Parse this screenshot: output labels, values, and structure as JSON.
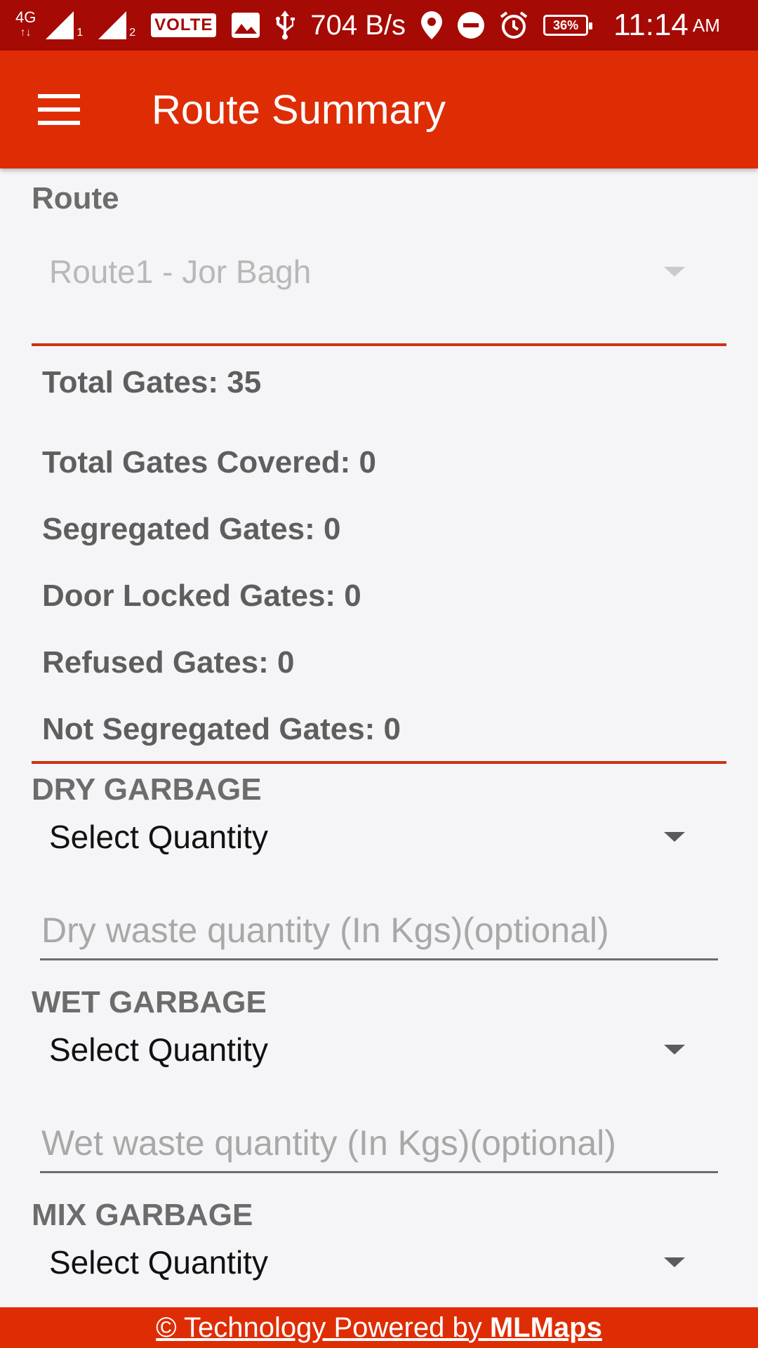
{
  "status_bar": {
    "network": "4G",
    "network_arrows": "↑↓",
    "sim1": "1",
    "sim2": "2",
    "volte": "VOLTE",
    "speed": "704 B/s",
    "battery": "36%",
    "time": "11:14",
    "ampm": "AM",
    "icons": [
      "signal-icon",
      "image-icon",
      "usb-icon",
      "location-icon",
      "do-not-disturb-icon",
      "alarm-icon",
      "battery-icon"
    ]
  },
  "app_bar": {
    "title": "Route Summary",
    "menu_icon": "hamburger-menu-icon",
    "color": "#de2d05"
  },
  "route": {
    "label": "Route",
    "selected": "Route1 - Jor Bagh"
  },
  "stats": {
    "total_gates": "Total Gates: 35",
    "covered": "Total Gates Covered: 0",
    "segregated": "Segregated Gates: 0",
    "door_locked": "Door Locked Gates: 0",
    "refused": "Refused Gates: 0",
    "not_segregated": "Not Segregated Gates: 0"
  },
  "dry": {
    "label": "DRY GARBAGE",
    "select": "Select Quantity",
    "placeholder": "Dry waste quantity (In Kgs)(optional)"
  },
  "wet": {
    "label": "WET GARBAGE",
    "select": "Select Quantity",
    "placeholder": "Wet waste quantity (In Kgs)(optional)"
  },
  "mix": {
    "label": "MIX GARBAGE",
    "select": "Select Quantity"
  },
  "footer": {
    "prefix": "© Technology Powered by ",
    "brand": "MLMaps"
  },
  "colors": {
    "status_bar": "#a50a05",
    "accent": "#de2d05",
    "divider": "#cc3311"
  }
}
